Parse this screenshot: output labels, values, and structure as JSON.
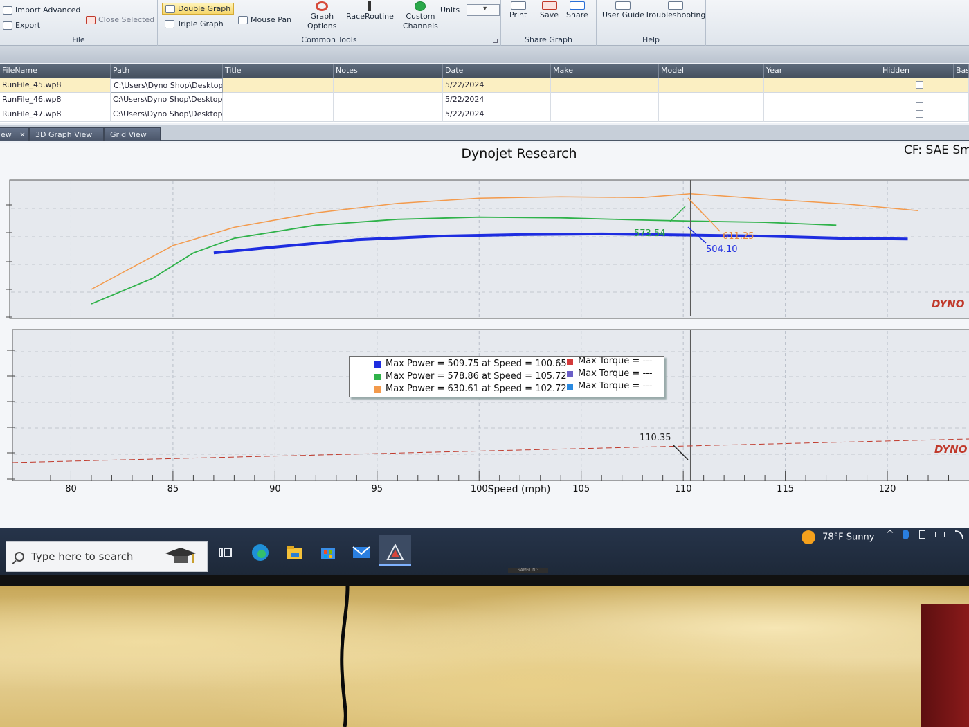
{
  "ribbon": {
    "file_group": {
      "label": "File",
      "import": "Import Advanced",
      "export": "Export",
      "close_selected": "Close Selected"
    },
    "common_tools": {
      "label": "Common Tools",
      "double_graph": "Double Graph",
      "triple_graph": "Triple Graph",
      "mouse_pan": "Mouse Pan",
      "graph_options_1": "Graph",
      "graph_options_2": "Options",
      "race_routine": "RaceRoutine",
      "custom_channels_1": "Custom",
      "custom_channels_2": "Channels",
      "units": "Units"
    },
    "share_graph": {
      "label": "Share Graph",
      "print": "Print",
      "save": "Save",
      "share": "Share"
    },
    "help": {
      "label": "Help",
      "user_guide": "User Guide",
      "troubleshooting": "Troubleshooting"
    }
  },
  "file_grid": {
    "columns": [
      "FileName",
      "Path",
      "Title",
      "Notes",
      "Date",
      "Make",
      "Model",
      "Year",
      "Hidden",
      "Base"
    ],
    "rows": [
      {
        "file": "RunFile_45.wp8",
        "path": "C:\\Users\\Dyno Shop\\Desktop...",
        "date": "5/22/2024"
      },
      {
        "file": "RunFile_46.wp8",
        "path": "C:\\Users\\Dyno Shop\\Desktop...",
        "date": "5/22/2024"
      },
      {
        "file": "RunFile_47.wp8",
        "path": "C:\\Users\\Dyno Shop\\Desktop...",
        "date": "5/22/2024"
      }
    ]
  },
  "tabs": {
    "view_tab": "ew",
    "close": "✕",
    "graph_3d": "3D Graph View",
    "grid_view": "Grid View"
  },
  "graph": {
    "title": "Dynojet Research",
    "correction": "CF: SAE Sm",
    "watermark": "DYNO",
    "xlabel": "Speed (mph)",
    "cursor_labels": {
      "green": "573.54",
      "orange": "611.25",
      "blue": "504.10",
      "bottom": "110.35"
    },
    "legend": {
      "power": [
        "Max Power = 509.75 at Speed = 100.65",
        "Max Power = 578.86 at Speed = 105.72",
        "Max Power = 630.61 at Speed = 102.72"
      ],
      "torque": [
        "Max Torque = ---",
        "Max Torque = ---",
        "Max Torque = ---"
      ]
    }
  },
  "chart_data": {
    "type": "line",
    "title": "Dynojet Research",
    "xlabel": "Speed (mph)",
    "xlim": [
      77,
      124
    ],
    "x_ticks": [
      80,
      85,
      90,
      95,
      100,
      105,
      110,
      115,
      120
    ],
    "cursor_x": 110.35,
    "series": [
      {
        "color": "#f39a4c",
        "x": [
          81,
          85,
          88,
          92,
          96,
          100,
          104,
          108,
          110.35,
          114,
          118,
          121.5
        ],
        "values": [
          480,
          540,
          565,
          585,
          598,
          605,
          607,
          606,
          611.25,
          604,
          597,
          588
        ]
      },
      {
        "color": "#2fb24a",
        "x": [
          81,
          84,
          86,
          88,
          92,
          96,
          100,
          104,
          108,
          110.35,
          114,
          117.5
        ],
        "values": [
          460,
          495,
          530,
          550,
          568,
          576,
          579,
          578,
          575,
          573.54,
          572,
          568
        ]
      },
      {
        "color": "#1e2de0",
        "x": [
          87,
          90,
          94,
          98,
          102,
          106,
          110.35,
          114,
          118,
          121
        ],
        "values": [
          530,
          538,
          548,
          553,
          555,
          556,
          504.1,
          553,
          550,
          549
        ]
      }
    ]
  },
  "taskbar": {
    "search_placeholder": "Type here to search",
    "weather": "78°F  Sunny"
  },
  "monitor_brand": "SAMSUNG"
}
